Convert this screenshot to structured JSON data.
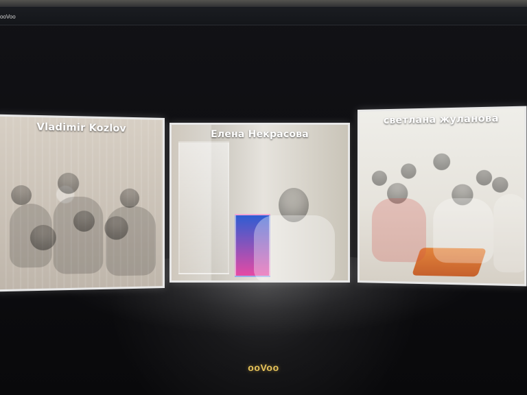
{
  "app": {
    "window_title": "ooVoo",
    "brand_logo_text": "ooVoo",
    "brand_color": "#e8c45a"
  },
  "participants": [
    {
      "name": "Vladimir Kozlov"
    },
    {
      "name": "Елена Некрасова"
    },
    {
      "name": "светлана жуланова"
    }
  ]
}
